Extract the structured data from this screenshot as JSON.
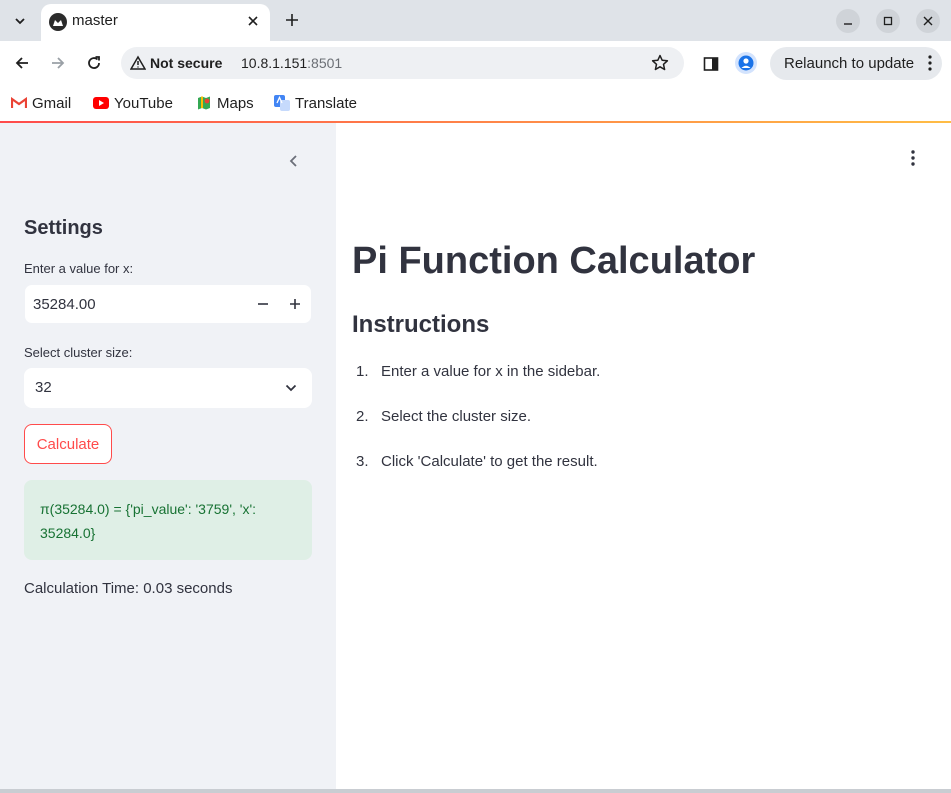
{
  "browser": {
    "tab_title": "master",
    "url_host": "10.8.1.151",
    "url_port": ":8501",
    "security_label": "Not secure",
    "relaunch_label": "Relaunch to update",
    "bookmarks": [
      {
        "label": "Gmail",
        "icon": "gmail-icon"
      },
      {
        "label": "YouTube",
        "icon": "youtube-icon"
      },
      {
        "label": "Maps",
        "icon": "maps-icon"
      },
      {
        "label": "Translate",
        "icon": "translate-icon"
      }
    ]
  },
  "sidebar": {
    "title": "Settings",
    "x_label": "Enter a value for x:",
    "x_value": "35284.00",
    "cluster_label": "Select cluster size:",
    "cluster_value": "32",
    "calculate_label": "Calculate",
    "result_text": "π(35284.0) = {'pi_value': '3759', 'x': 35284.0}",
    "time_text": "Calculation Time: 0.03 seconds"
  },
  "main": {
    "title": "Pi Function Calculator",
    "section_title": "Instructions",
    "steps": [
      {
        "num": "1.",
        "text": "Enter a value for x in the sidebar."
      },
      {
        "num": "2.",
        "text": "Select the cluster size."
      },
      {
        "num": "3.",
        "text": "Click 'Calculate' to get the result."
      }
    ]
  },
  "colors": {
    "accent": "#ff4b4b",
    "success_bg": "#dfefe6",
    "success_text": "#177233",
    "sidebar_bg": "#f0f2f6"
  }
}
